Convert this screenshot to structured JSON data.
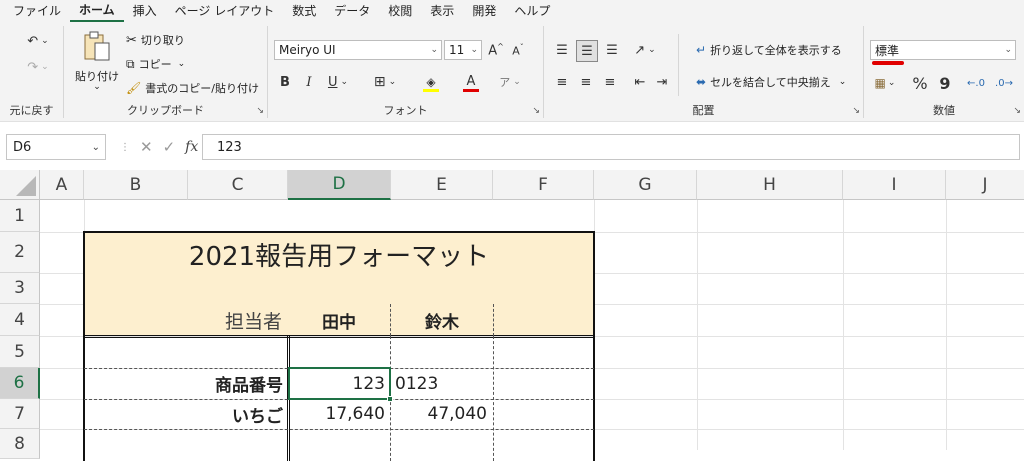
{
  "menu": {
    "tabs": [
      "ファイル",
      "ホーム",
      "挿入",
      "ページ レイアウト",
      "数式",
      "データ",
      "校閲",
      "表示",
      "開発",
      "ヘルプ"
    ]
  },
  "ribbon": {
    "undo": {
      "label": "元に戻す"
    },
    "clipboard": {
      "group_label": "クリップボード",
      "paste": "貼り付け",
      "cut": "切り取り",
      "copy": "コピー",
      "format_painter": "書式のコピー/貼り付け"
    },
    "font": {
      "group_label": "フォント",
      "font_name": "Meiryo UI",
      "font_size": "11",
      "bold": "B",
      "italic": "I",
      "underline": "U"
    },
    "alignment": {
      "group_label": "配置",
      "wrap_text": "折り返して全体を表示する",
      "merge_center": "セルを結合して中央揃え"
    },
    "number": {
      "group_label": "数値",
      "format": "標準",
      "percent": "%",
      "comma": "9"
    },
    "accent_color": "#1e7145",
    "highlight_color": "#e00000"
  },
  "formula_bar": {
    "name_box": "D6",
    "formula": "123"
  },
  "sheet": {
    "columns": [
      "A",
      "B",
      "C",
      "D",
      "E",
      "F",
      "G",
      "H",
      "I",
      "J"
    ],
    "rows": [
      "1",
      "2",
      "3",
      "4",
      "5",
      "6",
      "7",
      "8"
    ],
    "selected_cell": "D6",
    "title": "2021報告用フォーマット",
    "person_label": "担当者",
    "person1": "田中",
    "person2": "鈴木",
    "row6_label": "商品番号",
    "row6_d": "123",
    "row6_e": "0123",
    "row7_label": "いちご",
    "row7_d": "17,640",
    "row7_e": "47,040",
    "header_fill": "#fdefcf"
  }
}
